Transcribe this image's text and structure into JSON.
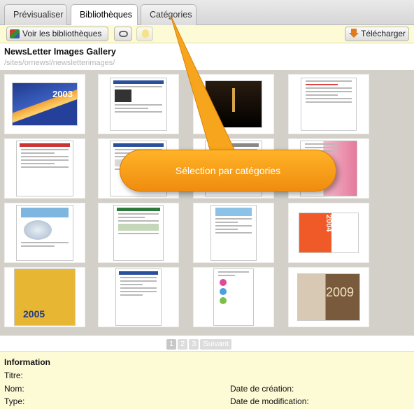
{
  "tabs": [
    {
      "label": "Prévisualiser"
    },
    {
      "label": "Bibliothèques"
    },
    {
      "label": "Catégories"
    }
  ],
  "toolbar": {
    "view_libraries": "Voir les bibliothèques",
    "download": "Télécharger"
  },
  "gallery": {
    "title": "NewsLetter Images Gallery",
    "path": "/sites/ornewsl/newsletterimages/"
  },
  "thumb_text": {
    "year_2003": "2003",
    "year_2004": "2004",
    "year_2005": "2005",
    "year_2009": "2009"
  },
  "callout": {
    "text": "Sélection par catégories"
  },
  "pagination": {
    "pages": [
      "1",
      "2",
      "3"
    ],
    "next": "Suivant"
  },
  "info": {
    "title": "Information",
    "titre": "Titre:",
    "nom": "Nom:",
    "type": "Type:",
    "date_creation": "Date de création:",
    "date_modification": "Date de modification:"
  },
  "colors": {
    "toolbar_bg": "#fdfbd6",
    "grid_bg": "#d2d0c9",
    "callout": "#f59a16"
  }
}
